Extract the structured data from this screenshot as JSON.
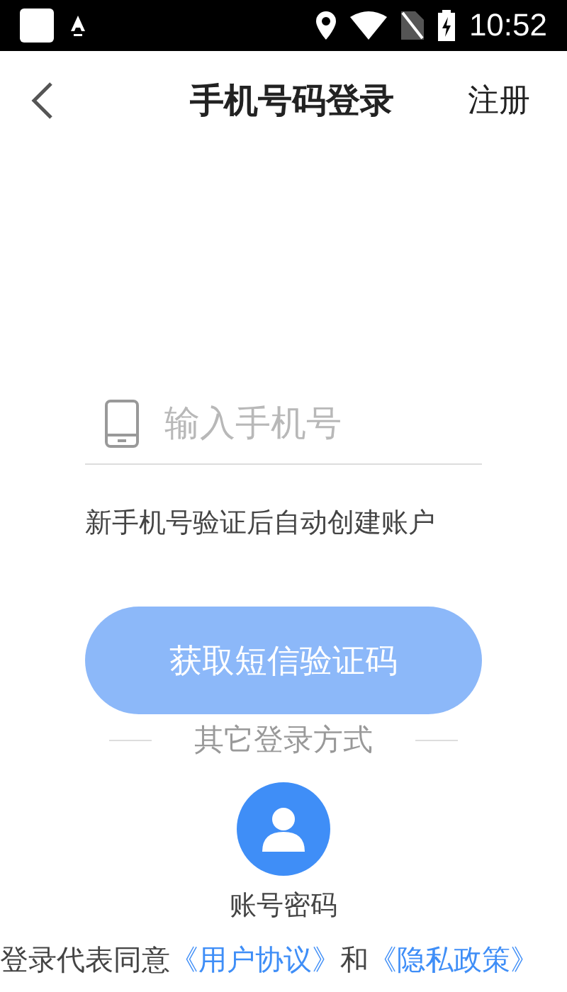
{
  "status_bar": {
    "time": "10:52"
  },
  "header": {
    "title": "手机号码登录",
    "action": "注册"
  },
  "phone_field": {
    "placeholder": "输入手机号"
  },
  "hint": "新手机号验证后自动创建账户",
  "submit_button": {
    "label": "获取短信验证码",
    "disabled": true
  },
  "other_login": {
    "label": "其它登录方式"
  },
  "methods": [
    {
      "label": "账号密码"
    }
  ],
  "agreement": {
    "prefix": "登录代表同意",
    "links": [
      "《用户协议》",
      "《隐私政策》"
    ],
    "joiner": "和"
  }
}
